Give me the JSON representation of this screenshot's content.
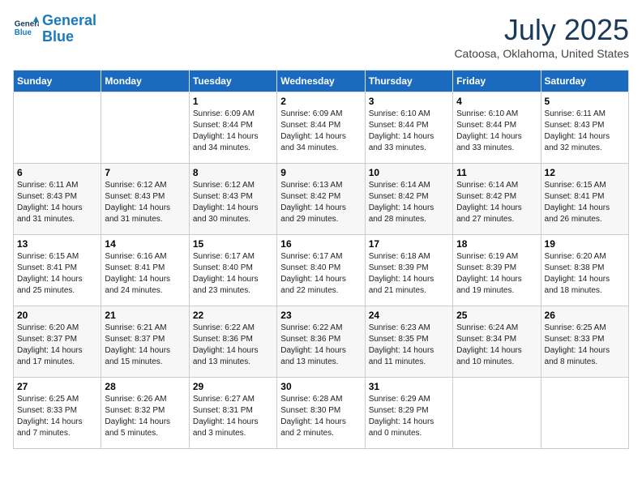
{
  "header": {
    "logo_line1": "General",
    "logo_line2": "Blue",
    "month": "July 2025",
    "location": "Catoosa, Oklahoma, United States"
  },
  "weekdays": [
    "Sunday",
    "Monday",
    "Tuesday",
    "Wednesday",
    "Thursday",
    "Friday",
    "Saturday"
  ],
  "weeks": [
    [
      {
        "day": "",
        "sunrise": "",
        "sunset": "",
        "daylight": ""
      },
      {
        "day": "",
        "sunrise": "",
        "sunset": "",
        "daylight": ""
      },
      {
        "day": "1",
        "sunrise": "Sunrise: 6:09 AM",
        "sunset": "Sunset: 8:44 PM",
        "daylight": "Daylight: 14 hours and 34 minutes."
      },
      {
        "day": "2",
        "sunrise": "Sunrise: 6:09 AM",
        "sunset": "Sunset: 8:44 PM",
        "daylight": "Daylight: 14 hours and 34 minutes."
      },
      {
        "day": "3",
        "sunrise": "Sunrise: 6:10 AM",
        "sunset": "Sunset: 8:44 PM",
        "daylight": "Daylight: 14 hours and 33 minutes."
      },
      {
        "day": "4",
        "sunrise": "Sunrise: 6:10 AM",
        "sunset": "Sunset: 8:44 PM",
        "daylight": "Daylight: 14 hours and 33 minutes."
      },
      {
        "day": "5",
        "sunrise": "Sunrise: 6:11 AM",
        "sunset": "Sunset: 8:43 PM",
        "daylight": "Daylight: 14 hours and 32 minutes."
      }
    ],
    [
      {
        "day": "6",
        "sunrise": "Sunrise: 6:11 AM",
        "sunset": "Sunset: 8:43 PM",
        "daylight": "Daylight: 14 hours and 31 minutes."
      },
      {
        "day": "7",
        "sunrise": "Sunrise: 6:12 AM",
        "sunset": "Sunset: 8:43 PM",
        "daylight": "Daylight: 14 hours and 31 minutes."
      },
      {
        "day": "8",
        "sunrise": "Sunrise: 6:12 AM",
        "sunset": "Sunset: 8:43 PM",
        "daylight": "Daylight: 14 hours and 30 minutes."
      },
      {
        "day": "9",
        "sunrise": "Sunrise: 6:13 AM",
        "sunset": "Sunset: 8:42 PM",
        "daylight": "Daylight: 14 hours and 29 minutes."
      },
      {
        "day": "10",
        "sunrise": "Sunrise: 6:14 AM",
        "sunset": "Sunset: 8:42 PM",
        "daylight": "Daylight: 14 hours and 28 minutes."
      },
      {
        "day": "11",
        "sunrise": "Sunrise: 6:14 AM",
        "sunset": "Sunset: 8:42 PM",
        "daylight": "Daylight: 14 hours and 27 minutes."
      },
      {
        "day": "12",
        "sunrise": "Sunrise: 6:15 AM",
        "sunset": "Sunset: 8:41 PM",
        "daylight": "Daylight: 14 hours and 26 minutes."
      }
    ],
    [
      {
        "day": "13",
        "sunrise": "Sunrise: 6:15 AM",
        "sunset": "Sunset: 8:41 PM",
        "daylight": "Daylight: 14 hours and 25 minutes."
      },
      {
        "day": "14",
        "sunrise": "Sunrise: 6:16 AM",
        "sunset": "Sunset: 8:41 PM",
        "daylight": "Daylight: 14 hours and 24 minutes."
      },
      {
        "day": "15",
        "sunrise": "Sunrise: 6:17 AM",
        "sunset": "Sunset: 8:40 PM",
        "daylight": "Daylight: 14 hours and 23 minutes."
      },
      {
        "day": "16",
        "sunrise": "Sunrise: 6:17 AM",
        "sunset": "Sunset: 8:40 PM",
        "daylight": "Daylight: 14 hours and 22 minutes."
      },
      {
        "day": "17",
        "sunrise": "Sunrise: 6:18 AM",
        "sunset": "Sunset: 8:39 PM",
        "daylight": "Daylight: 14 hours and 21 minutes."
      },
      {
        "day": "18",
        "sunrise": "Sunrise: 6:19 AM",
        "sunset": "Sunset: 8:39 PM",
        "daylight": "Daylight: 14 hours and 19 minutes."
      },
      {
        "day": "19",
        "sunrise": "Sunrise: 6:20 AM",
        "sunset": "Sunset: 8:38 PM",
        "daylight": "Daylight: 14 hours and 18 minutes."
      }
    ],
    [
      {
        "day": "20",
        "sunrise": "Sunrise: 6:20 AM",
        "sunset": "Sunset: 8:37 PM",
        "daylight": "Daylight: 14 hours and 17 minutes."
      },
      {
        "day": "21",
        "sunrise": "Sunrise: 6:21 AM",
        "sunset": "Sunset: 8:37 PM",
        "daylight": "Daylight: 14 hours and 15 minutes."
      },
      {
        "day": "22",
        "sunrise": "Sunrise: 6:22 AM",
        "sunset": "Sunset: 8:36 PM",
        "daylight": "Daylight: 14 hours and 13 minutes."
      },
      {
        "day": "23",
        "sunrise": "Sunrise: 6:22 AM",
        "sunset": "Sunset: 8:36 PM",
        "daylight": "Daylight: 14 hours and 13 minutes."
      },
      {
        "day": "24",
        "sunrise": "Sunrise: 6:23 AM",
        "sunset": "Sunset: 8:35 PM",
        "daylight": "Daylight: 14 hours and 11 minutes."
      },
      {
        "day": "25",
        "sunrise": "Sunrise: 6:24 AM",
        "sunset": "Sunset: 8:34 PM",
        "daylight": "Daylight: 14 hours and 10 minutes."
      },
      {
        "day": "26",
        "sunrise": "Sunrise: 6:25 AM",
        "sunset": "Sunset: 8:33 PM",
        "daylight": "Daylight: 14 hours and 8 minutes."
      }
    ],
    [
      {
        "day": "27",
        "sunrise": "Sunrise: 6:25 AM",
        "sunset": "Sunset: 8:33 PM",
        "daylight": "Daylight: 14 hours and 7 minutes."
      },
      {
        "day": "28",
        "sunrise": "Sunrise: 6:26 AM",
        "sunset": "Sunset: 8:32 PM",
        "daylight": "Daylight: 14 hours and 5 minutes."
      },
      {
        "day": "29",
        "sunrise": "Sunrise: 6:27 AM",
        "sunset": "Sunset: 8:31 PM",
        "daylight": "Daylight: 14 hours and 3 minutes."
      },
      {
        "day": "30",
        "sunrise": "Sunrise: 6:28 AM",
        "sunset": "Sunset: 8:30 PM",
        "daylight": "Daylight: 14 hours and 2 minutes."
      },
      {
        "day": "31",
        "sunrise": "Sunrise: 6:29 AM",
        "sunset": "Sunset: 8:29 PM",
        "daylight": "Daylight: 14 hours and 0 minutes."
      },
      {
        "day": "",
        "sunrise": "",
        "sunset": "",
        "daylight": ""
      },
      {
        "day": "",
        "sunrise": "",
        "sunset": "",
        "daylight": ""
      }
    ]
  ]
}
